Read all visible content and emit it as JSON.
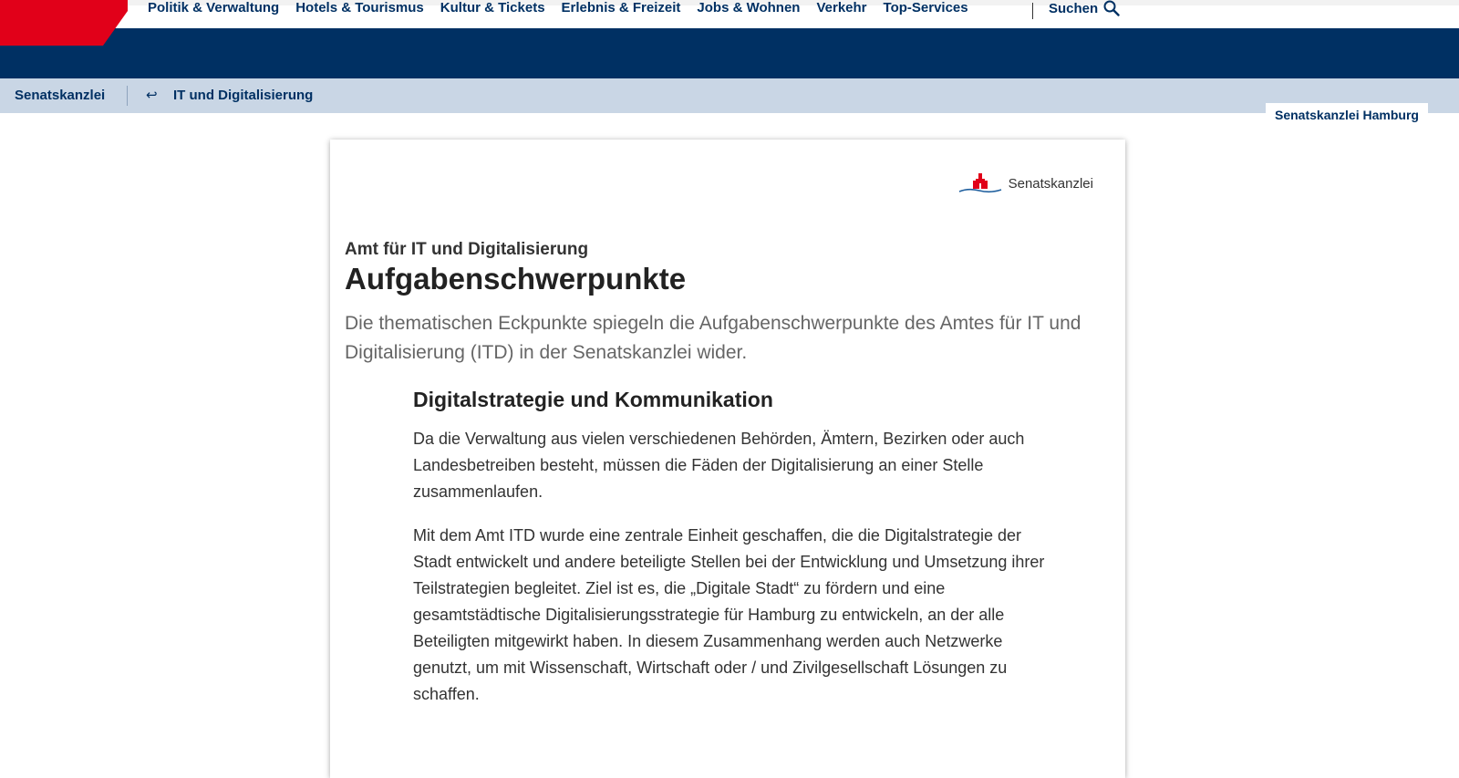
{
  "topnav": {
    "items": [
      "Politik & Verwaltung",
      "Hotels & Tourismus",
      "Kultur & Tickets",
      "Erlebnis & Freizeit",
      "Jobs & Wohnen",
      "Verkehr",
      "Top-Services"
    ],
    "search_label": "Suchen",
    "icons": {
      "search": "search-icon"
    },
    "colors": {
      "brand_red": "#e10019",
      "brand_blue": "#003063"
    }
  },
  "breadcrumb": {
    "home": "Senatskanzlei",
    "back_icon": "↩",
    "current": "IT und Digitalisierung"
  },
  "site_tag": "Senatskanzlei Hamburg",
  "card": {
    "logo_text": "Senatskanzlei",
    "kicker": "Amt für IT und Digitalisierung",
    "title": "Aufgabenschwerpunkte",
    "lead": "Die thematischen Eckpunkte spiegeln die Aufgabenschwerpunkte des Amtes für IT und Digitalisierung (ITD) in der Senatskanzlei wider.",
    "section": {
      "heading": "Digitalstrategie und Kommunikation",
      "paragraphs": [
        "Da die Verwaltung aus vielen verschiedenen Behörden, Ämtern, Bezirken oder auch Landesbetreiben besteht, müssen die Fäden der Digitalisierung an einer Stelle zusammenlaufen.",
        "Mit dem Amt ITD wurde eine zentrale Einheit geschaffen, die die Digitalstrategie der Stadt entwickelt und andere beteiligte Stellen bei der Entwicklung und Umsetzung ihrer Teilstrategien begleitet. Ziel ist es, die „Digitale Stadt“ zu fördern und eine gesamtstädtische Digitalisierungsstrategie für Hamburg zu entwickeln, an der alle Beteiligten mitgewirkt haben. In diesem Zusammenhang werden auch Netzwerke genutzt, um mit Wissenschaft, Wirtschaft oder / und Zivilgesellschaft Lösungen zu schaffen."
      ]
    }
  }
}
